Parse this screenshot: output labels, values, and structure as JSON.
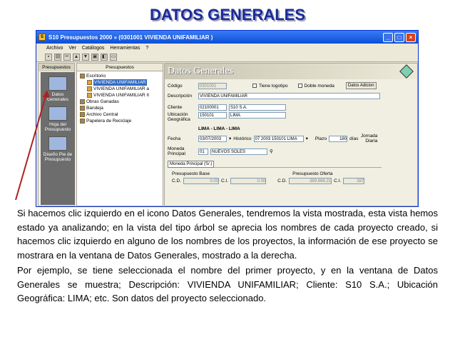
{
  "slide_title": "DATOS GENERALES",
  "window": {
    "title": "S10 Presupuestos 2000 » (0301001 VIVIENDA UNIFAMILIAR )",
    "menu": [
      "Archivo",
      "Ver",
      "Catálogos",
      "Herramientas",
      "?"
    ]
  },
  "leftbar": {
    "header": "Presupuestos",
    "items": [
      "Datos Generales",
      "Hoja del Presupuesto",
      "Diseño Pie de Presupuesto"
    ]
  },
  "tree": {
    "header": "Presupuestos",
    "nodes": [
      {
        "label": "Escritorio",
        "level": 0
      },
      {
        "label": "VIVIENDA UNIFAMILIAR",
        "level": 1,
        "selected": true
      },
      {
        "label": "VIVIENDA UNIFAMILIAR a",
        "level": 1
      },
      {
        "label": "VIVIENDA UNIFAMILIAR II",
        "level": 1
      },
      {
        "label": "Obras Ganadas",
        "level": 0
      },
      {
        "label": "Bandeja",
        "level": 0
      },
      {
        "label": "Archivo Central",
        "level": 0
      },
      {
        "label": "Papelera de Reciclaje",
        "level": 0
      }
    ]
  },
  "form": {
    "header": "Datos Generales",
    "codigo_label": "Código",
    "codigo": "0301001",
    "tiene_logotipo": "Tiene logotipo",
    "doble_moneda": "Doble moneda",
    "datos_adicionales": "Datos Adicion",
    "descripcion_label": "Descripción",
    "descripcion": "VIVIENDA UNIFAMILIAR",
    "cliente_label": "Cliente",
    "cliente_code": "02100001",
    "cliente_name": "S10 S.A.",
    "ubicacion_label": "Ubicación Geográfica",
    "ubicacion_code": "150101",
    "ubicacion_name": "LIMA",
    "ubicacion_full": "LIMA - LIMA - LIMA",
    "fecha_label": "Fecha",
    "fecha": "03/07/2003",
    "historico_label": "Histórico",
    "historico": "07 2003 150101 LIMA",
    "plazo_label": "Plazo",
    "plazo": "180",
    "dias": "días",
    "jornada": "Jornada Diaria",
    "moneda_label": "Moneda Principal",
    "moneda_code": "01",
    "moneda_name": "NUEVOS SOLES",
    "tab_label": "Moneda Principal (S/.)",
    "base_label": "Presupuesto Base",
    "oferta_label": "Presupuesto Oferta",
    "cd": "C.D.",
    "ci": "C.I.",
    "base_cd": "0.00",
    "base_ci": "0.00",
    "oferta_cd": "389,666.21",
    "oferta_ci": "387"
  },
  "paragraphs": [
    "Si hacemos clic izquierdo en el icono Datos Generales, tendremos la vista mostrada, esta vista hemos estado ya analizando; en la vista del tipo árbol se aprecia los nombres de cada proyecto creado, si hacemos clic izquierdo en alguno de los nombres de los proyectos, la información de ese proyecto se mostrara en la ventana de Datos Generales, mostrado a la derecha.",
    "Por ejemplo, se tiene seleccionada el nombre del primer proyecto, y en la ventana de Datos Generales se muestra; Descripción: VIVIENDA UNIFAMILIAR; Cliente: S10 S.A.; Ubicación Geográfica: LIMA; etc. Son datos del proyecto seleccionado."
  ],
  "colors": {
    "title": "#1a2a9a",
    "arrow": "#b02020",
    "xp_blue": "#0a4fd8"
  }
}
